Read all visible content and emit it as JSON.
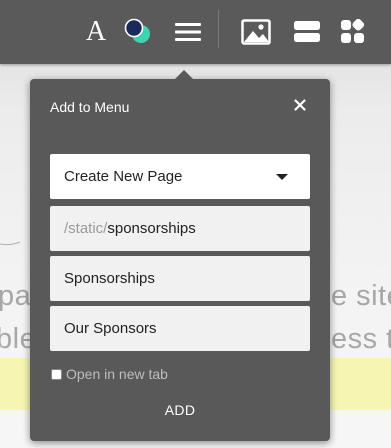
{
  "background": {
    "line1_left": "pa",
    "line1_right": "e site",
    "line2_left": "ble",
    "line2_right": "ess t"
  },
  "toolbar": {
    "font_glyph": "A",
    "icons": [
      "font-icon",
      "color-palette-icon",
      "menu-icon",
      "image-icon",
      "layout-icon",
      "blocks-icon"
    ]
  },
  "popover": {
    "title": "Add to Menu",
    "close_glyph": "×",
    "page_type": {
      "selected": "Create New Page"
    },
    "url": {
      "prefix": "/static/",
      "value": "sponsorships"
    },
    "label_value": "Sponsorships",
    "title_value": "Our Sponsors",
    "open_new_tab": {
      "label": "Open in new tab",
      "checked": false
    },
    "add_label": "ADD"
  },
  "colors": {
    "toolbar": "#5a5a5a",
    "popover": "#595959",
    "highlight": "#f6f6b2",
    "color_dot_dark": "#1a2a5a",
    "color_dot_teal": "#3fd3b0"
  }
}
